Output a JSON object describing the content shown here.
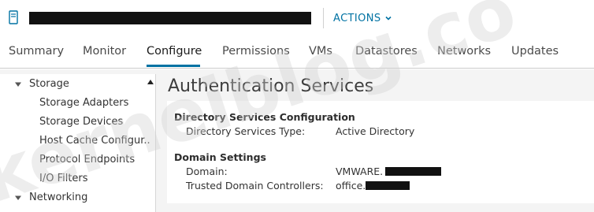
{
  "header": {
    "host_icon": "server-host-icon",
    "actions_label": "ACTIONS",
    "actions_icon": "chevron-down-icon"
  },
  "tabs": [
    {
      "label": "Summary"
    },
    {
      "label": "Monitor"
    },
    {
      "label": "Configure",
      "active": true
    },
    {
      "label": "Permissions"
    },
    {
      "label": "VMs"
    },
    {
      "label": "Datastores"
    },
    {
      "label": "Networks"
    },
    {
      "label": "Updates"
    }
  ],
  "tree": {
    "items": [
      {
        "label": "Storage",
        "expanded": true
      },
      {
        "label": "Storage Adapters"
      },
      {
        "label": "Storage Devices"
      },
      {
        "label": "Host Cache Configur.."
      },
      {
        "label": "Protocol Endpoints"
      },
      {
        "label": "I/O Filters"
      },
      {
        "label": "Networking",
        "expanded": true
      }
    ]
  },
  "panel": {
    "title": "Authentication Services",
    "directory": {
      "heading": "Directory Services Configuration",
      "type_label": "Directory Services Type:",
      "type_value": "Active Directory"
    },
    "domain": {
      "heading": "Domain Settings",
      "domain_label": "Domain:",
      "domain_value": "VMWARE.",
      "controllers_label": "Trusted Domain Controllers:",
      "controllers_value": "office."
    }
  },
  "watermark": "kerneiblog.co",
  "colors": {
    "accent": "#0072a3",
    "background": "#f4f4f4",
    "watermark": "#e6e6e6"
  }
}
